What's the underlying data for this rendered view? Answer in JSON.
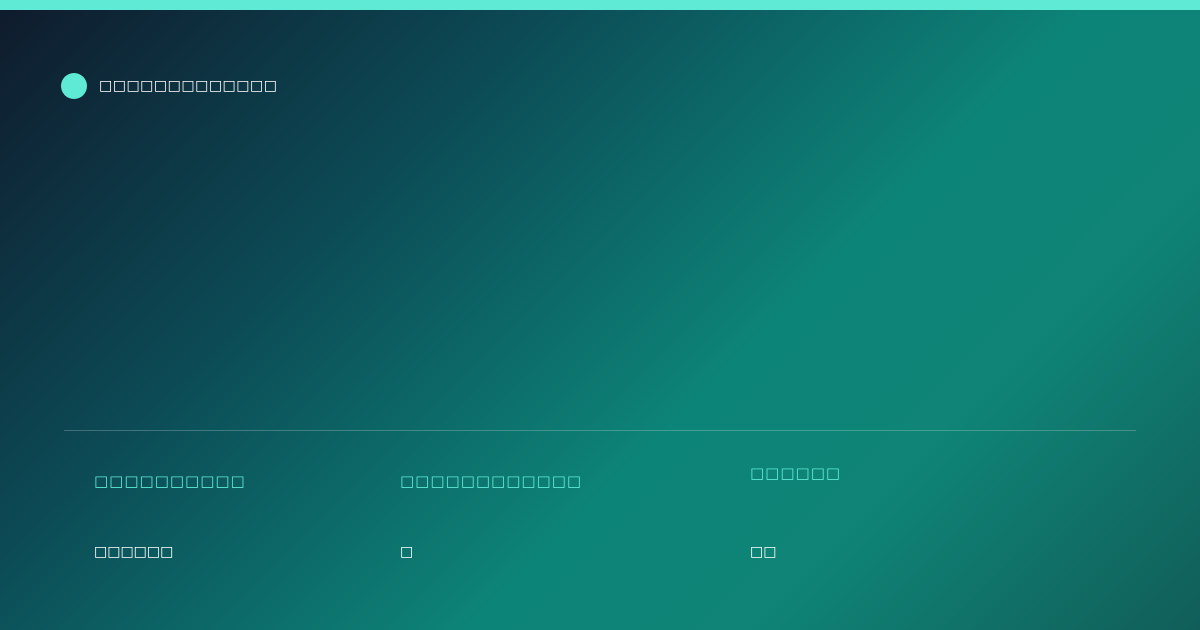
{
  "brand": {
    "name": "□□□□□□□□□□□□□",
    "accent_color": "#5eead4"
  },
  "stats": [
    {
      "label": "□□□□□□□□□□",
      "value": "□□□□□□"
    },
    {
      "label": "□□□□□□□□□□□□",
      "value": "□"
    },
    {
      "label": "□□□□□□",
      "value": "□□"
    }
  ]
}
